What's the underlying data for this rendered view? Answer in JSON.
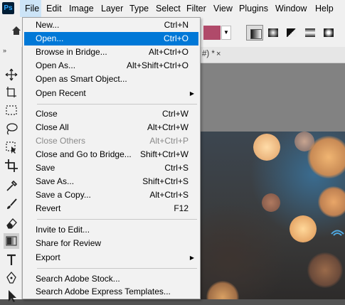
{
  "app": {
    "logo_text": "Ps"
  },
  "menubar": {
    "items": [
      {
        "label": "File",
        "active": true
      },
      {
        "label": "Edit"
      },
      {
        "label": "Image"
      },
      {
        "label": "Layer"
      },
      {
        "label": "Type"
      },
      {
        "label": "Select"
      },
      {
        "label": "Filter"
      },
      {
        "label": "View"
      },
      {
        "label": "Plugins"
      },
      {
        "label": "Window"
      },
      {
        "label": "Help"
      }
    ]
  },
  "options_bar": {
    "gradient_color": "#b04a6a",
    "gradient_types": [
      "linear-gradient-icon",
      "radial-gradient-icon",
      "angle-gradient-icon",
      "reflected-gradient-icon",
      "diamond-gradient-icon"
    ],
    "selected_gradient_type": "linear-gradient-icon"
  },
  "document": {
    "tab_title_fragment": "#) *",
    "tab_close": "×"
  },
  "file_menu": {
    "items": [
      {
        "label": "New...",
        "shortcut": "Ctrl+N"
      },
      {
        "label": "Open...",
        "shortcut": "Ctrl+O",
        "highlighted": true
      },
      {
        "label": "Browse in Bridge...",
        "shortcut": "Alt+Ctrl+O"
      },
      {
        "label": "Open As...",
        "shortcut": "Alt+Shift+Ctrl+O"
      },
      {
        "label": "Open as Smart Object..."
      },
      {
        "label": "Open Recent",
        "submenu": true
      },
      {
        "label": "Close",
        "shortcut": "Ctrl+W"
      },
      {
        "label": "Close All",
        "shortcut": "Alt+Ctrl+W"
      },
      {
        "label": "Close Others",
        "shortcut": "Alt+Ctrl+P",
        "disabled": true
      },
      {
        "label": "Close and Go to Bridge...",
        "shortcut": "Shift+Ctrl+W"
      },
      {
        "label": "Save",
        "shortcut": "Ctrl+S"
      },
      {
        "label": "Save As...",
        "shortcut": "Shift+Ctrl+S"
      },
      {
        "label": "Save a Copy...",
        "shortcut": "Alt+Ctrl+S"
      },
      {
        "label": "Revert",
        "shortcut": "F12"
      },
      {
        "label": "Invite to Edit..."
      },
      {
        "label": "Share for Review"
      },
      {
        "label": "Export",
        "submenu": true
      },
      {
        "label": "Search Adobe Stock..."
      },
      {
        "label": "Search Adobe Express Templates..."
      }
    ]
  },
  "toolbar": {
    "tools": [
      "move-tool-icon",
      "artboard-tool-icon",
      "marquee-tool-icon",
      "lasso-tool-icon",
      "object-select-tool-icon",
      "crop-tool-icon",
      "eyedropper-tool-icon",
      "brush-tool-icon",
      "eraser-tool-icon",
      "gradient-tool-icon",
      "type-tool-icon",
      "pen-tool-icon",
      "path-select-tool-icon"
    ],
    "selected": "gradient-tool-icon"
  }
}
